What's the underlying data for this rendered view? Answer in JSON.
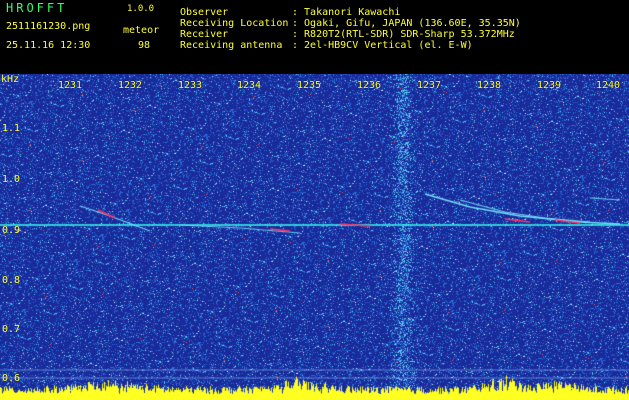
{
  "header": {
    "app_name": "HROFFT",
    "version": "1.0.0",
    "filename": "2511161230.png",
    "datetime": "25.11.16 12:30",
    "meteor_label": "meteor",
    "meteor_count": "98",
    "info_labels": [
      "Observer",
      "Receiving Location",
      "Receiver",
      "Receiving antenna"
    ],
    "info_values": [
      ": Takanori Kawachi",
      ": Ogaki, Gifu, JAPAN (136.60E, 35.35N)",
      ": R820T2(RTL-SDR) SDR-Sharp 53.372MHz",
      ": 2el-HB9CV Vertical (el. E-W)"
    ]
  },
  "spectrogram": {
    "y_unit": "kHz",
    "y_ticks": [
      "1.1",
      "1.0",
      "0.9",
      "0.8",
      "0.7",
      "0.6"
    ],
    "x_ticks": [
      "1231",
      "1232",
      "1233",
      "1234",
      "1235",
      "1236",
      "1237",
      "1238",
      "1239",
      "1240"
    ],
    "colors": {
      "background": "#1a2a9a",
      "noise": "#2a6ad0",
      "signal": "#33ffee",
      "echo": "#ff3366",
      "meter": "#ffff22",
      "text": "#ffff33"
    }
  }
}
